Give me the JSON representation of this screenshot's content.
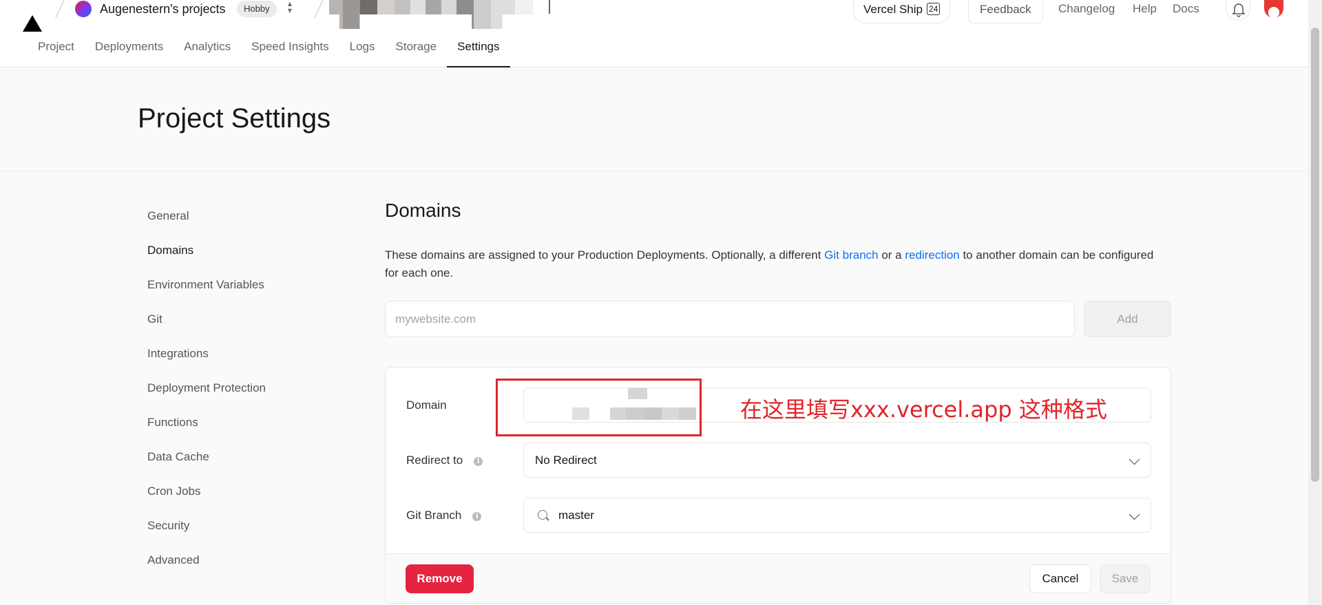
{
  "header": {
    "team_name": "Augenestern's projects",
    "plan_badge": "Hobby",
    "vercel_ship_label": "Vercel Ship",
    "vercel_ship_year": "24",
    "feedback_label": "Feedback",
    "links": [
      "Changelog",
      "Help",
      "Docs"
    ]
  },
  "tabs": [
    "Project",
    "Deployments",
    "Analytics",
    "Speed Insights",
    "Logs",
    "Storage",
    "Settings"
  ],
  "active_tab": "Settings",
  "page_title": "Project Settings",
  "sidebar": {
    "items": [
      "General",
      "Domains",
      "Environment Variables",
      "Git",
      "Integrations",
      "Deployment Protection",
      "Functions",
      "Data Cache",
      "Cron Jobs",
      "Security",
      "Advanced"
    ],
    "active": "Domains"
  },
  "domains": {
    "title": "Domains",
    "description_1": "These domains are assigned to your Production Deployments. Optionally, a different ",
    "link_git_branch": "Git branch",
    "description_2": " or a ",
    "link_redirection": "redirection",
    "description_3": " to another domain can be configured for each one.",
    "input_placeholder": "mywebsite.com",
    "add_label": "Add"
  },
  "card": {
    "domain_label": "Domain",
    "redirect_label": "Redirect to",
    "redirect_value": "No Redirect",
    "git_branch_label": "Git Branch",
    "git_branch_value": "master",
    "remove_label": "Remove",
    "cancel_label": "Cancel",
    "save_label": "Save"
  },
  "annotation": "在这里填写xxx.vercel.app 这种格式",
  "colors": {
    "accent_link": "#0a72ef",
    "danger": "#e5243f",
    "annotation_red": "#e0242a"
  }
}
